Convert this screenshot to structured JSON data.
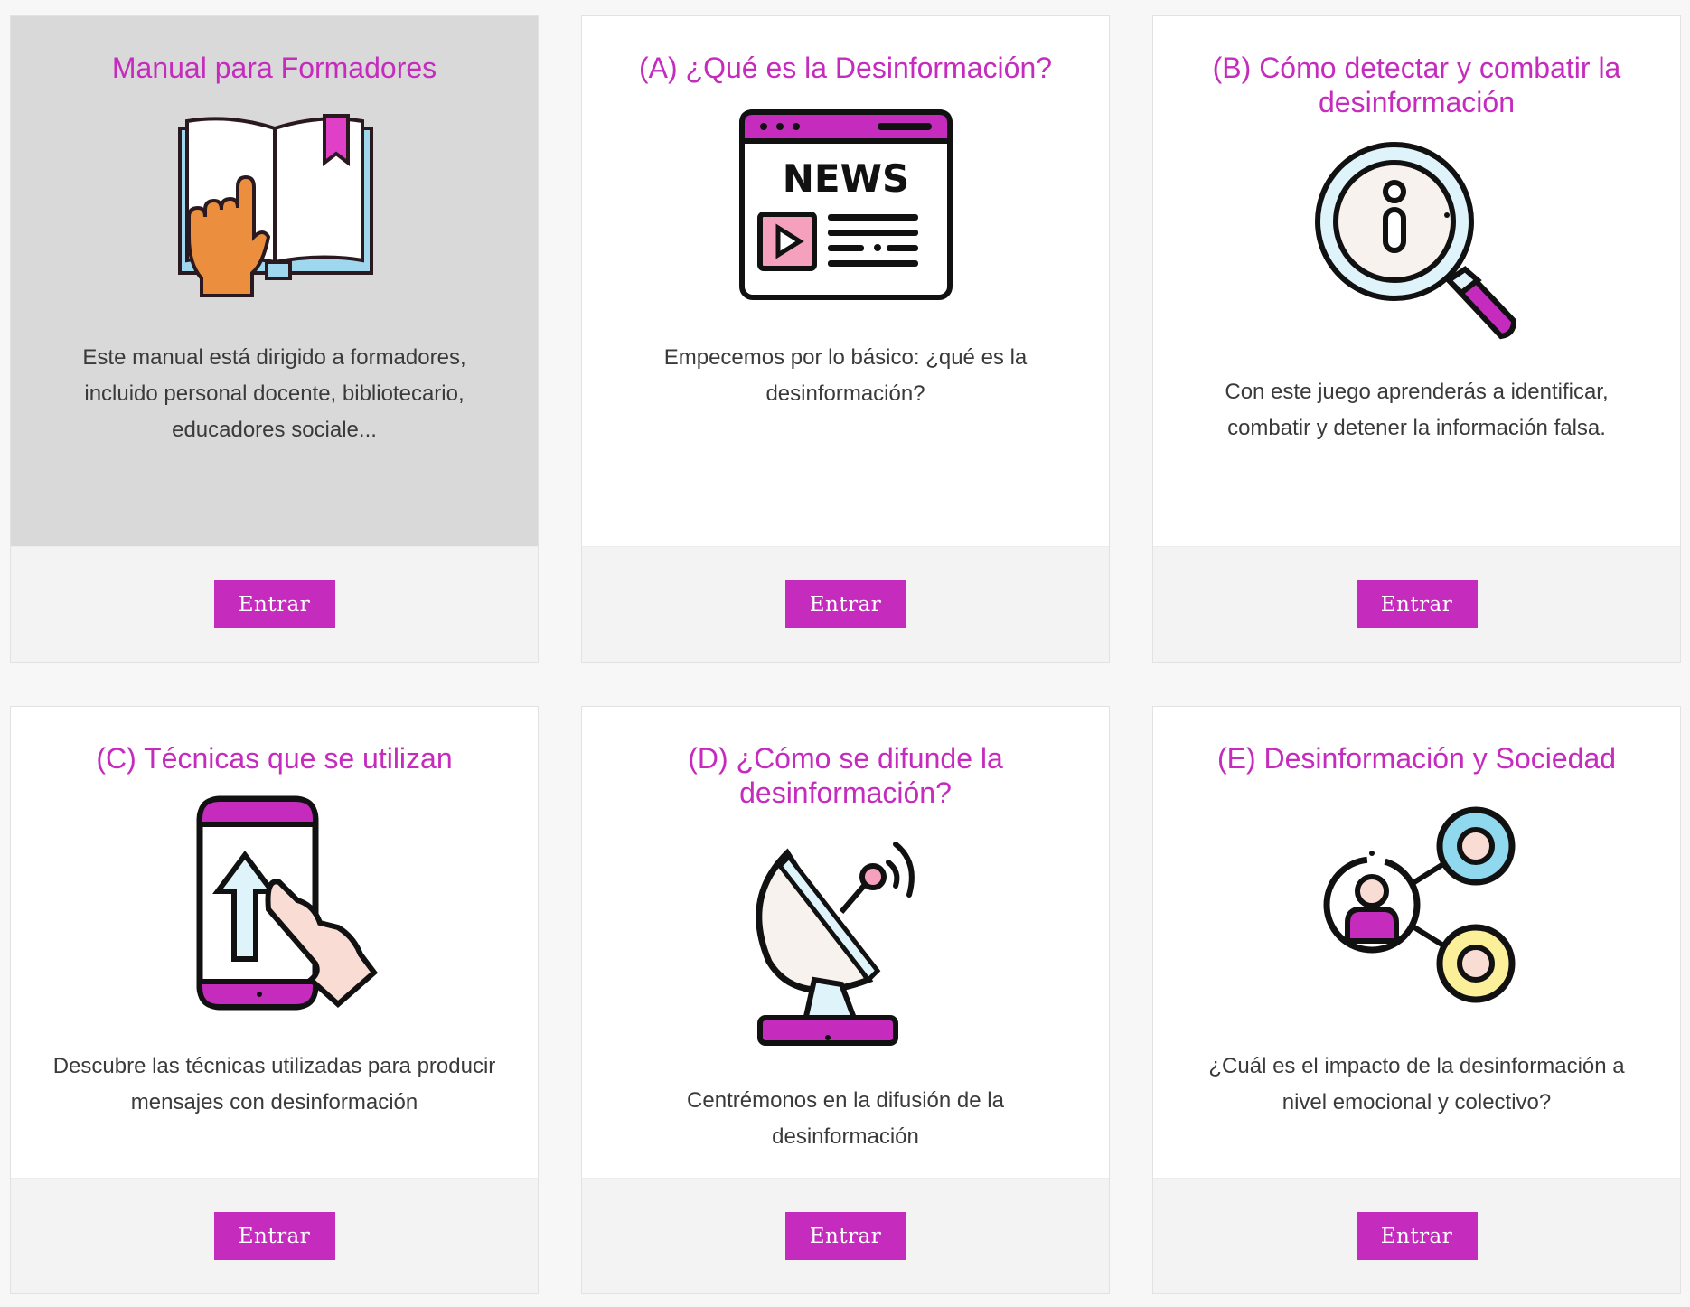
{
  "accent_color": "#c52bbd",
  "cards": [
    {
      "title": "Manual para Formadores",
      "icon": "book-pointing-hand-icon",
      "description": "Este manual está dirigido a formadores, incluido personal docente, bibliotecario, educadores sociale...",
      "button_label": "Entrar",
      "highlighted": true
    },
    {
      "title": "(A) ¿Qué es la Desinformación?",
      "icon": "news-browser-icon",
      "icon_text": "NEWS",
      "description": "Empecemos por lo básico: ¿qué es la desinformación?",
      "button_label": "Entrar"
    },
    {
      "title": "(B) Cómo detectar y combatir la desinformación",
      "icon": "magnifier-info-icon",
      "description": "Con este juego aprenderás a identificar, combatir y detener la información falsa.",
      "button_label": "Entrar"
    },
    {
      "title": "(C) Técnicas que se utilizan",
      "icon": "smartphone-touch-icon",
      "description": "Descubre las técnicas utilizadas para producir mensajes con desinformación",
      "button_label": "Entrar"
    },
    {
      "title": "(D) ¿Cómo se difunde la desinformación?",
      "icon": "satellite-dish-icon",
      "description": "Centrémonos en la difusión de la desinformación",
      "button_label": "Entrar"
    },
    {
      "title": "(E) Desinformación y Sociedad",
      "icon": "social-network-icon",
      "description": "¿Cuál es el impacto de la desinformación a nivel emocional y colectivo?",
      "button_label": "Entrar"
    }
  ]
}
